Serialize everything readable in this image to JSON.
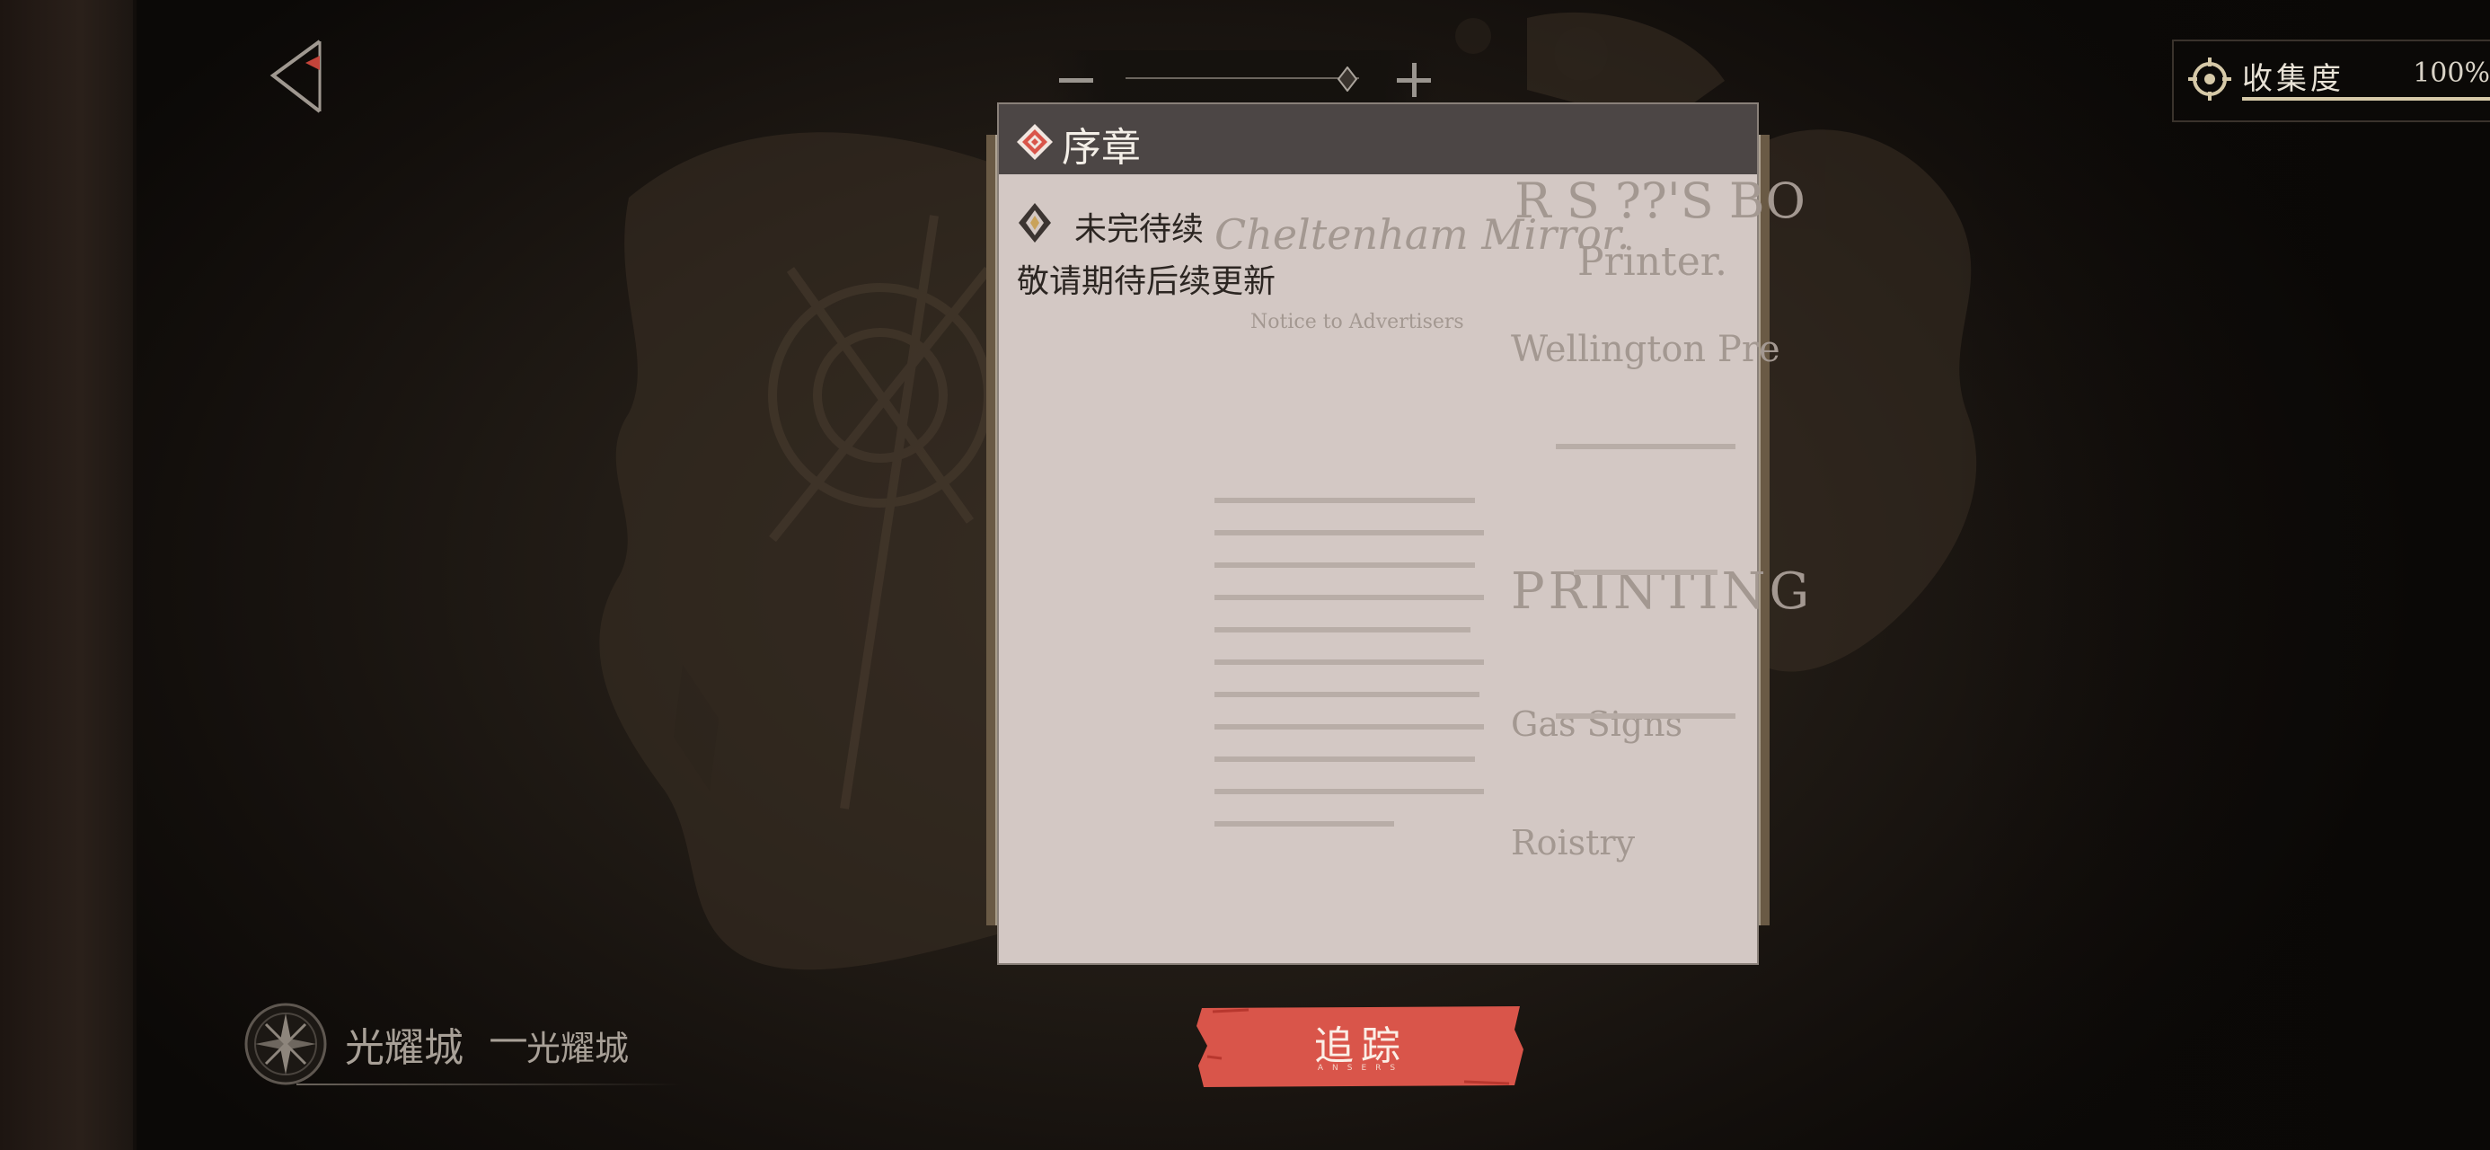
{
  "header": {
    "back_icon": "back-arrow-icon",
    "zoom": {
      "minus_icon": "minus-icon",
      "plus_icon": "plus-icon",
      "level": 0.95
    }
  },
  "collection": {
    "label": "收集度",
    "value": "100%",
    "progress": 1.0,
    "icon": "compass-target-icon"
  },
  "chapter_panel": {
    "title": "序章",
    "title_icon": "chapter-diamond-icon",
    "quest": {
      "icon": "quest-marker-icon",
      "title": "未完待续",
      "description": "敬请期待后续更新"
    }
  },
  "background_paper": {
    "lines": [
      "Cheltenham Mirror.",
      "R S ??'S BO",
      "Printer.",
      "Wellington Pre",
      "PRINTING",
      "Notice to Advertisers",
      "Gas Signs",
      "Roistry"
    ]
  },
  "track_button": {
    "label": "追踪",
    "sublabel": "ANSERS"
  },
  "location": {
    "icon": "compass-rose-icon",
    "name": "光耀城",
    "separator": "—",
    "sub_name": "光耀城"
  },
  "colors": {
    "accent_red": "#d9554a",
    "panel_bg": "#d3c8c4",
    "header_bg": "#4c4645",
    "progress_fill": "#d6c9a8"
  }
}
